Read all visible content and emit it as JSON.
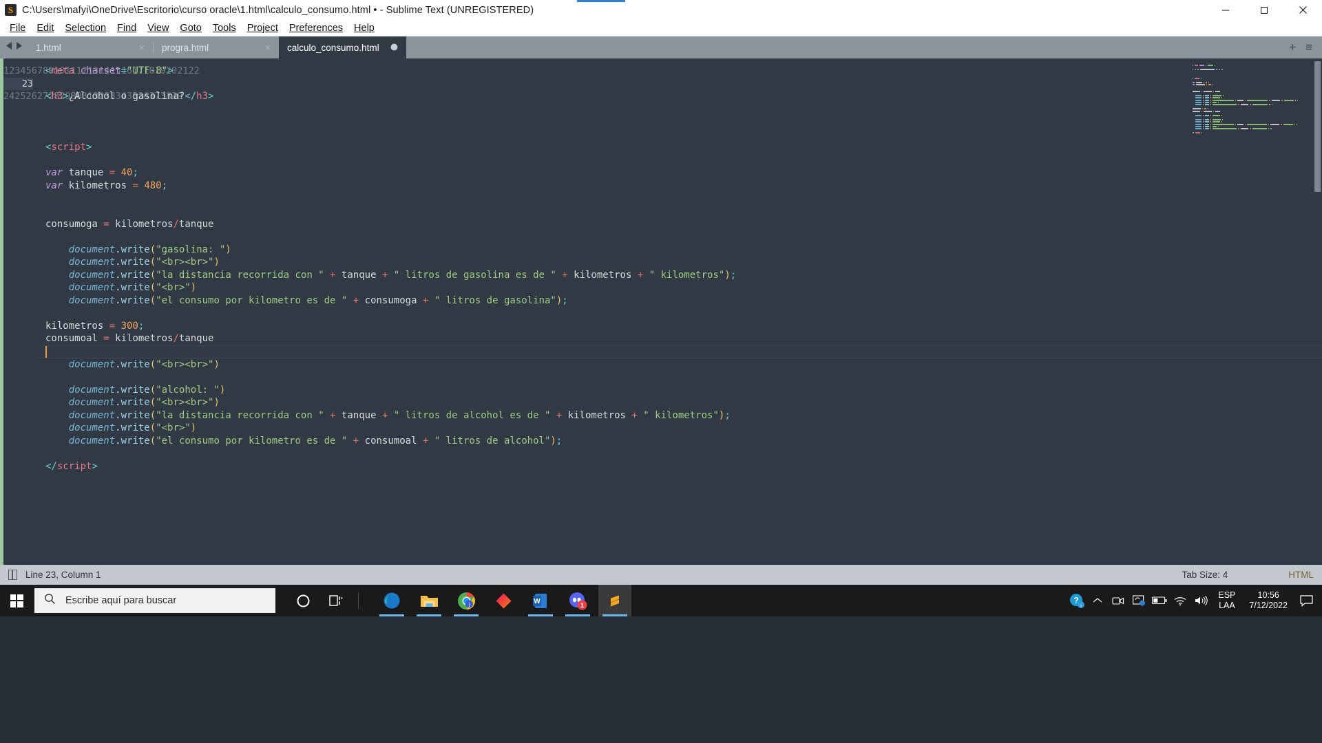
{
  "window": {
    "title": "C:\\Users\\mafyi\\OneDrive\\Escritorio\\curso oracle\\1.html\\calculo_consumo.html • - Sublime Text (UNREGISTERED)",
    "app_logo": "S",
    "controls": {
      "minimize": "minimize-icon",
      "maximize": "maximize-icon",
      "close": "close-icon"
    }
  },
  "menu": {
    "items": [
      {
        "label": "File"
      },
      {
        "label": "Edit"
      },
      {
        "label": "Selection"
      },
      {
        "label": "Find"
      },
      {
        "label": "View"
      },
      {
        "label": "Goto"
      },
      {
        "label": "Tools"
      },
      {
        "label": "Project"
      },
      {
        "label": "Preferences"
      },
      {
        "label": "Help"
      }
    ]
  },
  "tabs": {
    "prev_icon": "chevron-left-icon",
    "next_icon": "chevron-right-icon",
    "items": [
      {
        "label": "1.html",
        "active": false,
        "close": "×",
        "dirty": false
      },
      {
        "label": "progra.html",
        "active": false,
        "close": "×",
        "dirty": false
      },
      {
        "label": "calculo_consumo.html",
        "active": true,
        "close": "",
        "dirty": true
      }
    ],
    "add_label": "+",
    "menu_label": "≡"
  },
  "editor": {
    "first_line": 1,
    "total_lines": 39,
    "cursor_line": 23,
    "lines": [
      {
        "n": 1,
        "tokens": [
          {
            "t": "punc",
            "v": "<"
          },
          {
            "t": "tag",
            "v": "meta"
          },
          {
            "t": "plain",
            "v": " "
          },
          {
            "t": "attr",
            "v": "charset"
          },
          {
            "t": "punc",
            "v": "="
          },
          {
            "t": "str",
            "v": "\"UTF-8\""
          },
          {
            "t": "punc",
            "v": ">"
          }
        ]
      },
      {
        "n": 2,
        "tokens": []
      },
      {
        "n": 3,
        "tokens": [
          {
            "t": "punc",
            "v": "<"
          },
          {
            "t": "tag",
            "v": "h3"
          },
          {
            "t": "punc",
            "v": ">"
          },
          {
            "t": "plain",
            "v": "¿Alcohol o gasolina?"
          },
          {
            "t": "punc",
            "v": "</"
          },
          {
            "t": "tag",
            "v": "h3"
          },
          {
            "t": "punc",
            "v": ">"
          }
        ]
      },
      {
        "n": 4,
        "tokens": []
      },
      {
        "n": 5,
        "tokens": []
      },
      {
        "n": 6,
        "tokens": []
      },
      {
        "n": 7,
        "tokens": [
          {
            "t": "punc",
            "v": "<"
          },
          {
            "t": "tag",
            "v": "script"
          },
          {
            "t": "punc",
            "v": ">"
          }
        ]
      },
      {
        "n": 8,
        "tokens": []
      },
      {
        "n": 9,
        "tokens": [
          {
            "t": "kw",
            "v": "var"
          },
          {
            "t": "plain",
            "v": " tanque "
          },
          {
            "t": "op",
            "v": "="
          },
          {
            "t": "plain",
            "v": " "
          },
          {
            "t": "num",
            "v": "40"
          },
          {
            "t": "punc",
            "v": ";"
          }
        ]
      },
      {
        "n": 10,
        "tokens": [
          {
            "t": "kw",
            "v": "var"
          },
          {
            "t": "plain",
            "v": " kilometros "
          },
          {
            "t": "op",
            "v": "="
          },
          {
            "t": "plain",
            "v": " "
          },
          {
            "t": "num",
            "v": "480"
          },
          {
            "t": "punc",
            "v": ";"
          }
        ]
      },
      {
        "n": 11,
        "tokens": []
      },
      {
        "n": 12,
        "tokens": []
      },
      {
        "n": 13,
        "tokens": [
          {
            "t": "plain",
            "v": "consumoga "
          },
          {
            "t": "op",
            "v": "="
          },
          {
            "t": "plain",
            "v": " kilometros"
          },
          {
            "t": "op",
            "v": "/"
          },
          {
            "t": "plain",
            "v": "tanque"
          }
        ]
      },
      {
        "n": 14,
        "tokens": []
      },
      {
        "n": 15,
        "tokens": [
          {
            "t": "plain",
            "v": "    "
          },
          {
            "t": "var",
            "v": "document"
          },
          {
            "t": "plain",
            "v": "."
          },
          {
            "t": "fn",
            "v": "write"
          },
          {
            "t": "paren",
            "v": "("
          },
          {
            "t": "str",
            "v": "\"gasolina: \""
          },
          {
            "t": "paren",
            "v": ")"
          }
        ]
      },
      {
        "n": 16,
        "tokens": [
          {
            "t": "plain",
            "v": "    "
          },
          {
            "t": "var",
            "v": "document"
          },
          {
            "t": "plain",
            "v": "."
          },
          {
            "t": "fn",
            "v": "write"
          },
          {
            "t": "paren",
            "v": "("
          },
          {
            "t": "str",
            "v": "\"<br><br>\""
          },
          {
            "t": "paren",
            "v": ")"
          }
        ]
      },
      {
        "n": 17,
        "tokens": [
          {
            "t": "plain",
            "v": "    "
          },
          {
            "t": "var",
            "v": "document"
          },
          {
            "t": "plain",
            "v": "."
          },
          {
            "t": "fn",
            "v": "write"
          },
          {
            "t": "paren",
            "v": "("
          },
          {
            "t": "str",
            "v": "\"la distancia recorrida con \""
          },
          {
            "t": "plain",
            "v": " "
          },
          {
            "t": "op",
            "v": "+"
          },
          {
            "t": "plain",
            "v": " tanque "
          },
          {
            "t": "op",
            "v": "+"
          },
          {
            "t": "plain",
            "v": " "
          },
          {
            "t": "str",
            "v": "\" litros de gasolina es de \""
          },
          {
            "t": "plain",
            "v": " "
          },
          {
            "t": "op",
            "v": "+"
          },
          {
            "t": "plain",
            "v": " kilometros "
          },
          {
            "t": "op",
            "v": "+"
          },
          {
            "t": "plain",
            "v": " "
          },
          {
            "t": "str",
            "v": "\" kilometros\""
          },
          {
            "t": "paren",
            "v": ")"
          },
          {
            "t": "punc",
            "v": ";"
          }
        ]
      },
      {
        "n": 18,
        "tokens": [
          {
            "t": "plain",
            "v": "    "
          },
          {
            "t": "var",
            "v": "document"
          },
          {
            "t": "plain",
            "v": "."
          },
          {
            "t": "fn",
            "v": "write"
          },
          {
            "t": "paren",
            "v": "("
          },
          {
            "t": "str",
            "v": "\"<br>\""
          },
          {
            "t": "paren",
            "v": ")"
          }
        ]
      },
      {
        "n": 19,
        "tokens": [
          {
            "t": "plain",
            "v": "    "
          },
          {
            "t": "var",
            "v": "document"
          },
          {
            "t": "plain",
            "v": "."
          },
          {
            "t": "fn",
            "v": "write"
          },
          {
            "t": "paren",
            "v": "("
          },
          {
            "t": "str",
            "v": "\"el consumo por kilometro es de \""
          },
          {
            "t": "plain",
            "v": " "
          },
          {
            "t": "op",
            "v": "+"
          },
          {
            "t": "plain",
            "v": " consumoga "
          },
          {
            "t": "op",
            "v": "+"
          },
          {
            "t": "plain",
            "v": " "
          },
          {
            "t": "str",
            "v": "\" litros de gasolina\""
          },
          {
            "t": "paren",
            "v": ")"
          },
          {
            "t": "punc",
            "v": ";"
          }
        ]
      },
      {
        "n": 20,
        "tokens": []
      },
      {
        "n": 21,
        "tokens": [
          {
            "t": "plain",
            "v": "kilometros "
          },
          {
            "t": "op",
            "v": "="
          },
          {
            "t": "plain",
            "v": " "
          },
          {
            "t": "num",
            "v": "300"
          },
          {
            "t": "punc",
            "v": ";"
          }
        ]
      },
      {
        "n": 22,
        "tokens": [
          {
            "t": "plain",
            "v": "consumoal "
          },
          {
            "t": "op",
            "v": "="
          },
          {
            "t": "plain",
            "v": " kilometros"
          },
          {
            "t": "op",
            "v": "/"
          },
          {
            "t": "plain",
            "v": "tanque"
          }
        ]
      },
      {
        "n": 23,
        "tokens": []
      },
      {
        "n": 24,
        "tokens": [
          {
            "t": "plain",
            "v": "    "
          },
          {
            "t": "var",
            "v": "document"
          },
          {
            "t": "plain",
            "v": "."
          },
          {
            "t": "fn",
            "v": "write"
          },
          {
            "t": "paren",
            "v": "("
          },
          {
            "t": "str",
            "v": "\"<br><br>\""
          },
          {
            "t": "paren",
            "v": ")"
          }
        ]
      },
      {
        "n": 25,
        "tokens": []
      },
      {
        "n": 26,
        "tokens": [
          {
            "t": "plain",
            "v": "    "
          },
          {
            "t": "var",
            "v": "document"
          },
          {
            "t": "plain",
            "v": "."
          },
          {
            "t": "fn",
            "v": "write"
          },
          {
            "t": "paren",
            "v": "("
          },
          {
            "t": "str",
            "v": "\"alcohol: \""
          },
          {
            "t": "paren",
            "v": ")"
          }
        ]
      },
      {
        "n": 27,
        "tokens": [
          {
            "t": "plain",
            "v": "    "
          },
          {
            "t": "var",
            "v": "document"
          },
          {
            "t": "plain",
            "v": "."
          },
          {
            "t": "fn",
            "v": "write"
          },
          {
            "t": "paren",
            "v": "("
          },
          {
            "t": "str",
            "v": "\"<br><br>\""
          },
          {
            "t": "paren",
            "v": ")"
          }
        ]
      },
      {
        "n": 28,
        "tokens": [
          {
            "t": "plain",
            "v": "    "
          },
          {
            "t": "var",
            "v": "document"
          },
          {
            "t": "plain",
            "v": "."
          },
          {
            "t": "fn",
            "v": "write"
          },
          {
            "t": "paren",
            "v": "("
          },
          {
            "t": "str",
            "v": "\"la distancia recorrida con \""
          },
          {
            "t": "plain",
            "v": " "
          },
          {
            "t": "op",
            "v": "+"
          },
          {
            "t": "plain",
            "v": " tanque "
          },
          {
            "t": "op",
            "v": "+"
          },
          {
            "t": "plain",
            "v": " "
          },
          {
            "t": "str",
            "v": "\" litros de alcohol es de \""
          },
          {
            "t": "plain",
            "v": " "
          },
          {
            "t": "op",
            "v": "+"
          },
          {
            "t": "plain",
            "v": " kilometros "
          },
          {
            "t": "op",
            "v": "+"
          },
          {
            "t": "plain",
            "v": " "
          },
          {
            "t": "str",
            "v": "\" kilometros\""
          },
          {
            "t": "paren",
            "v": ")"
          },
          {
            "t": "punc",
            "v": ";"
          }
        ]
      },
      {
        "n": 29,
        "tokens": [
          {
            "t": "plain",
            "v": "    "
          },
          {
            "t": "var",
            "v": "document"
          },
          {
            "t": "plain",
            "v": "."
          },
          {
            "t": "fn",
            "v": "write"
          },
          {
            "t": "paren",
            "v": "("
          },
          {
            "t": "str",
            "v": "\"<br>\""
          },
          {
            "t": "paren",
            "v": ")"
          }
        ]
      },
      {
        "n": 30,
        "tokens": [
          {
            "t": "plain",
            "v": "    "
          },
          {
            "t": "var",
            "v": "document"
          },
          {
            "t": "plain",
            "v": "."
          },
          {
            "t": "fn",
            "v": "write"
          },
          {
            "t": "paren",
            "v": "("
          },
          {
            "t": "str",
            "v": "\"el consumo por kilometro es de \""
          },
          {
            "t": "plain",
            "v": " "
          },
          {
            "t": "op",
            "v": "+"
          },
          {
            "t": "plain",
            "v": " consumoal "
          },
          {
            "t": "op",
            "v": "+"
          },
          {
            "t": "plain",
            "v": " "
          },
          {
            "t": "str",
            "v": "\" litros de alcohol\""
          },
          {
            "t": "paren",
            "v": ")"
          },
          {
            "t": "punc",
            "v": ";"
          }
        ]
      },
      {
        "n": 31,
        "tokens": []
      },
      {
        "n": 32,
        "tokens": [
          {
            "t": "punc",
            "v": "</"
          },
          {
            "t": "tag",
            "v": "script"
          },
          {
            "t": "punc",
            "v": ">"
          }
        ]
      },
      {
        "n": 33,
        "tokens": []
      },
      {
        "n": 34,
        "tokens": []
      },
      {
        "n": 35,
        "tokens": []
      },
      {
        "n": 36,
        "tokens": []
      },
      {
        "n": 37,
        "tokens": []
      },
      {
        "n": 38,
        "tokens": []
      },
      {
        "n": 39,
        "tokens": []
      }
    ]
  },
  "statusbar": {
    "position": "Line 23, Column 1",
    "tab_size": "Tab Size: 4",
    "syntax": "HTML"
  },
  "taskbar": {
    "start": "windows-logo-icon",
    "search_placeholder": "Escribe aquí para buscar",
    "search_value": "",
    "cortana": "cortana-icon",
    "task_view": "task-view-icon",
    "apps": [
      {
        "name": "microsoft-edge",
        "running": true,
        "active": false
      },
      {
        "name": "file-explorer",
        "running": true,
        "active": false
      },
      {
        "name": "google-chrome",
        "running": true,
        "active": false
      },
      {
        "name": "adobe-xd",
        "running": false,
        "active": false
      },
      {
        "name": "microsoft-word",
        "running": true,
        "active": false
      },
      {
        "name": "discord",
        "running": true,
        "active": false,
        "badge": "1"
      },
      {
        "name": "sublime-text",
        "running": true,
        "active": true
      }
    ],
    "tray": {
      "help": "help-icon",
      "chevron": "show-hidden-icons-icon",
      "camera": "camera-icon",
      "sync": "onedrive-sync-icon",
      "battery": "battery-icon",
      "wifi": "wifi-icon",
      "volume": "volume-icon",
      "language_line1": "ESP",
      "language_line2": "LAA",
      "time": "10:56",
      "date": "7/12/2022",
      "notifications": "action-center-icon"
    }
  },
  "colors": {
    "editor_bg": "#313a44",
    "tab_active_bg": "#323b45",
    "tabbar_bg": "#8b939d",
    "statusbar_bg": "#c3c8cf",
    "taskbar_bg": "#1a1a1a",
    "accent": "#6cb8ef",
    "caret": "#f2a13d",
    "string": "#9fcb82",
    "tag": "#e4798c",
    "number": "#f2a45f",
    "keyword": "#c397d8"
  }
}
